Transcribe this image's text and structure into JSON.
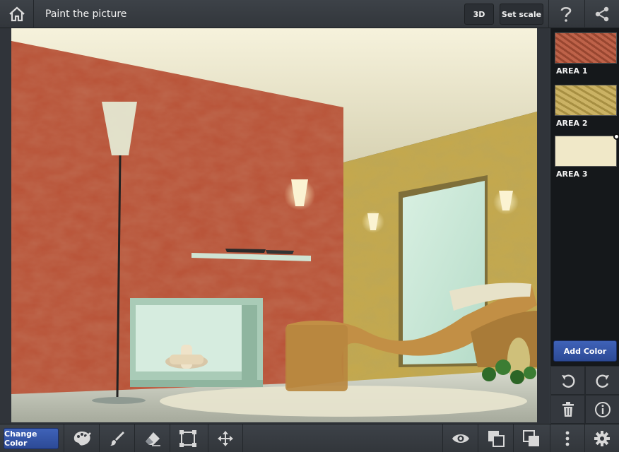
{
  "app": {
    "title": "Paint the picture"
  },
  "toolbar": {
    "btn_3d": "3D",
    "btn_set_scale": "Set scale"
  },
  "areas": [
    {
      "label": "AREA 1",
      "color": "#b9553a"
    },
    {
      "label": "AREA 2",
      "color": "#c4a84e"
    },
    {
      "label": "AREA 3",
      "color": "#f0e8c8"
    }
  ],
  "side": {
    "add_color_label": "Add Color"
  },
  "bottom": {
    "change_color_label": "Change Color"
  },
  "colors": {
    "accent": "#3355aa",
    "bar": "#373b40",
    "panel": "#15181b"
  },
  "icons": {
    "home": "home-icon",
    "help": "help-icon",
    "share": "share-icon",
    "undo": "undo-icon",
    "redo": "redo-icon",
    "delete": "trash-icon",
    "info": "info-icon",
    "palette": "palette-icon",
    "brush": "brush-icon",
    "eraser": "eraser-icon",
    "select": "selection-icon",
    "move": "move-icon",
    "eye": "eye-icon",
    "bring_front": "bring-front-icon",
    "send_back": "send-back-icon",
    "more": "more-icon",
    "settings": "gear-icon"
  }
}
